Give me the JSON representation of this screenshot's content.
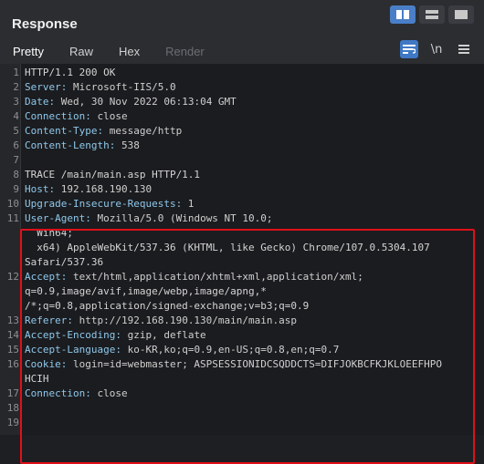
{
  "header": {
    "title": "Response",
    "tabs": [
      "Pretty",
      "Raw",
      "Hex",
      "Render"
    ],
    "active_tab": "Pretty",
    "icons": [
      "split-view-icon",
      "horizontal-view-icon",
      "single-view-icon",
      "wrap-icon",
      "newline-icon",
      "menu-icon"
    ],
    "newline_label": "\\n"
  },
  "colors": {
    "accent": "#ff6633",
    "highlight_border": "#e0101a",
    "active_button": "#4a7fc7"
  },
  "lines": [
    {
      "num": "1",
      "text": "HTTP/1.1 200 OK"
    },
    {
      "num": "2",
      "key": "Server:",
      "value": " Microsoft-IIS/5.0"
    },
    {
      "num": "3",
      "key": "Date:",
      "value": " Wed, 30 Nov 2022 06:13:04 GMT"
    },
    {
      "num": "4",
      "key": "Connection:",
      "value": " close"
    },
    {
      "num": "5",
      "key": "Content-Type:",
      "value": " message/http"
    },
    {
      "num": "6",
      "key": "Content-Length:",
      "value": " 538"
    },
    {
      "num": "7",
      "text": ""
    },
    {
      "num": "8",
      "text": "TRACE /main/main.asp HTTP/1.1"
    },
    {
      "num": "9",
      "key": "Host:",
      "value": " 192.168.190.130"
    },
    {
      "num": "10",
      "key": "Upgrade-Insecure-Requests:",
      "value": " 1"
    },
    {
      "num": "11",
      "key": "User-Agent:",
      "value": " Mozilla/5.0 (Windows NT 10.0;"
    },
    {
      "num": "",
      "text": "  Win64;"
    },
    {
      "num": "",
      "text": "  x64) AppleWebKit/537.36 (KHTML, like Gecko) Chrome/107.0.5304.107"
    },
    {
      "num": "",
      "text": "Safari/537.36"
    },
    {
      "num": "12",
      "key": "Accept:",
      "value": " text/html,application/xhtml+xml,application/xml;"
    },
    {
      "num": "",
      "text": "q=0.9,image/avif,image/webp,image/apng,*"
    },
    {
      "num": "",
      "text": "/*;q=0.8,application/signed-exchange;v=b3;q=0.9"
    },
    {
      "num": "13",
      "key": "Referer:",
      "value": " http://192.168.190.130/main/main.asp"
    },
    {
      "num": "14",
      "key": "Accept-Encoding:",
      "value": " gzip, deflate"
    },
    {
      "num": "15",
      "key": "Accept-Language:",
      "value": " ko-KR,ko;q=0.9,en-US;q=0.8,en;q=0.7"
    },
    {
      "num": "16",
      "key": "Cookie:",
      "value": " login=id=webmaster; ASPSESSIONIDCSQDDCTS=DIFJOKBCFKJKLOEEFHPO"
    },
    {
      "num": "",
      "text": "HCIH"
    },
    {
      "num": "17",
      "key": "Connection:",
      "value": " close"
    },
    {
      "num": "18",
      "text": ""
    },
    {
      "num": "19",
      "text": ""
    }
  ]
}
